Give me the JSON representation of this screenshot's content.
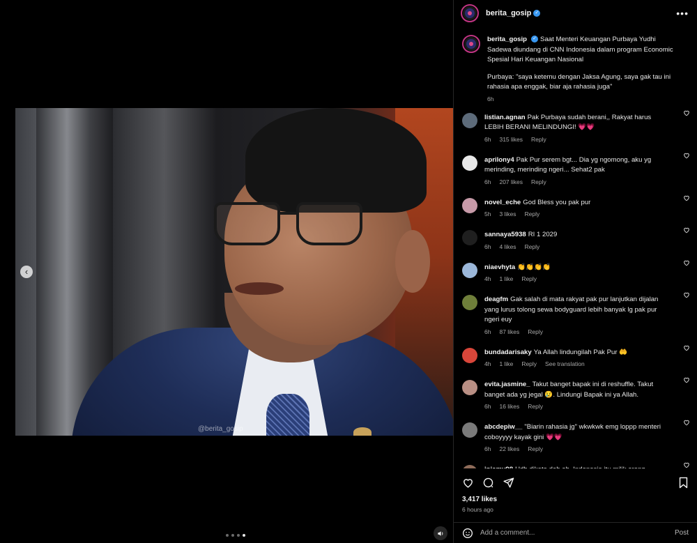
{
  "media": {
    "watermark": "@berita_gosip",
    "carousel_dots": [
      false,
      false,
      false,
      true
    ]
  },
  "post": {
    "author": "berita_gosip",
    "caption_1": "Saat Menteri Keuangan Purbaya Yudhi Sadewa diundang di CNN Indonesia dalam program Economic Spesial Hari Keuangan Nasional",
    "caption_2": "Purbaya: \"saya ketemu dengan Jaksa Agung, saya gak tau ini rahasia apa enggak, biar aja rahasia juga\"",
    "time": "6h"
  },
  "comments": [
    {
      "user": "listian.agnan",
      "text": "Pak Purbaya sudah berani,, Rakyat harus LEBIH BERANI MELINDUNGI! 💗💗",
      "time": "6h",
      "likes": "315 likes",
      "reply": "Reply",
      "avatar_color": "#5d6b7a"
    },
    {
      "user": "aprilony4",
      "text": "Pak Pur serem bgt... Dia yg ngomong, aku yg merinding, merinding ngeri... Sehat2 pak",
      "time": "6h",
      "likes": "207 likes",
      "reply": "Reply",
      "avatar_color": "#e8e8e8"
    },
    {
      "user": "novel_eche",
      "text": "God Bless you pak pur",
      "time": "5h",
      "likes": "3 likes",
      "reply": "Reply",
      "avatar_color": "#c79aa8"
    },
    {
      "user": "sannaya5938",
      "text": "RI 1 2029",
      "time": "6h",
      "likes": "4 likes",
      "reply": "Reply",
      "avatar_color": "#1f1f1f"
    },
    {
      "user": "niaevhyta",
      "text": "👏👏👏👏",
      "time": "4h",
      "likes": "1 like",
      "reply": "Reply",
      "avatar_color": "#9bb7d9"
    },
    {
      "user": "deagfm",
      "text": "Gak salah di mata rakyat pak pur lanjutkan dijalan yang lurus tolong sewa bodyguard lebih banyak lg pak pur ngeri euy",
      "time": "6h",
      "likes": "87 likes",
      "reply": "Reply",
      "avatar_color": "#6f7f3a"
    },
    {
      "user": "bundadarisaky",
      "text": "Ya Allah lindungilah Pak Pur 🤲",
      "time": "4h",
      "likes": "1 like",
      "reply": "Reply",
      "extra": "See translation",
      "avatar_color": "#d9463a"
    },
    {
      "user": "evita.jasmine_",
      "text": "Takut banget bapak ini di reshuffle. Takut banget ada yg jegal 😢. Lindungi Bapak ini ya Allah.",
      "time": "6h",
      "likes": "16 likes",
      "reply": "Reply",
      "avatar_color": "#b98f84"
    },
    {
      "user": "abcdepiw__",
      "text": "\"Biarin rahasia jg\" wkwkwk emg loppp menteri coboyyyy kayak gini 💗💗",
      "time": "6h",
      "likes": "22 likes",
      "reply": "Reply",
      "avatar_color": "#7a7a7a"
    },
    {
      "user": "iniamy98",
      "text": "Udh dikata dah ah. Indonesia itu milik orang",
      "time": "",
      "likes": "",
      "reply": "",
      "avatar_color": "#8f6c5a"
    }
  ],
  "footer": {
    "likes": "3,417 likes",
    "time": "6 hours ago",
    "comment_placeholder": "Add a comment...",
    "post_label": "Post"
  },
  "colors": {
    "background": "#000000",
    "muted_text": "#a8a8a8",
    "verified": "#3897f0",
    "story_ring": "#c13584"
  }
}
